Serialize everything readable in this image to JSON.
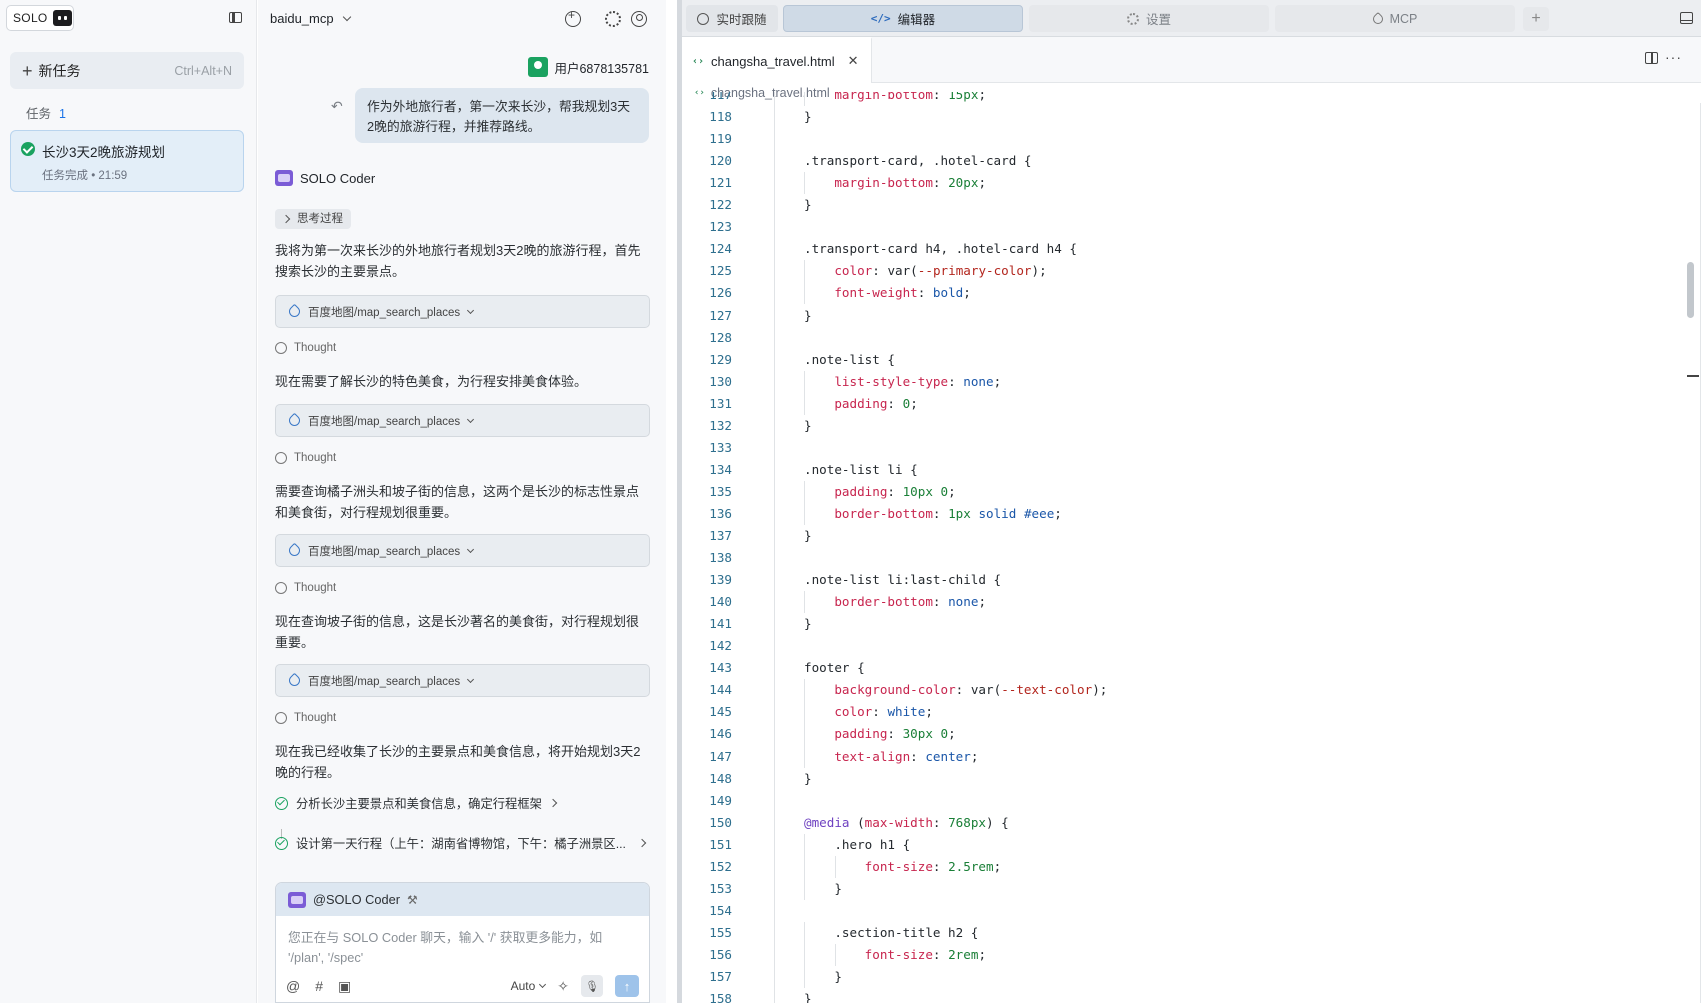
{
  "sidebar": {
    "logo_text": "SOLO",
    "new_task_label": "新任务",
    "new_task_shortcut": "Ctrl+Alt+N",
    "tasks_heading": "任务",
    "tasks_count": "1",
    "task": {
      "title": "长沙3天2晚旅游规划",
      "status": "任务完成 • 21:59"
    }
  },
  "chat": {
    "project_name": "baidu_mcp",
    "user_name": "用户6878135781",
    "user_message": "作为外地旅行者，第一次来长沙，帮我规划3天2晚的旅游行程，并推荐路线。",
    "agent_name": "SOLO Coder",
    "think_chip": "思考过程",
    "paragraphs": [
      "我将为第一次来长沙的外地旅行者规划3天2晚的旅游行程，首先搜索长沙的主要景点。",
      "现在需要了解长沙的特色美食，为行程安排美食体验。",
      "需要查询橘子洲头和坡子街的信息，这两个是长沙的标志性景点和美食街，对行程规划很重要。",
      "现在查询坡子街的信息，这是长沙著名的美食街，对行程规划很重要。",
      "现在我已经收集了长沙的主要景点和美食信息，将开始规划3天2晚的行程。"
    ],
    "tool_label": "百度地图/map_search_places",
    "thought_label": "Thought",
    "steps": [
      "分析长沙主要景点和美食信息，确定行程框架",
      "设计第一天行程（上午：湖南省博物馆，下午：橘子洲景区..."
    ],
    "input": {
      "mention": "@SOLO Coder",
      "placeholder": "您正在与 SOLO Coder 聊天，输入 '/' 获取更多能力，如 '/plan', '/spec'",
      "mode": "Auto"
    }
  },
  "editor": {
    "tabs": [
      "实时跟随",
      "编辑器",
      "设置",
      "MCP"
    ],
    "active_tab": "编辑器",
    "file_name": "changsha_travel.html",
    "breadcrumb": "changsha_travel.html",
    "first_line": 117,
    "lines": [
      "    margin-bottom: 15px;",
      "}",
      "",
      ".transport-card, .hotel-card {",
      "    margin-bottom: 20px;",
      "}",
      "",
      ".transport-card h4, .hotel-card h4 {",
      "    color: var(--primary-color);",
      "    font-weight: bold;",
      "}",
      "",
      ".note-list {",
      "    list-style-type: none;",
      "    padding: 0;",
      "}",
      "",
      ".note-list li {",
      "    padding: 10px 0;",
      "    border-bottom: 1px solid #eee;",
      "}",
      "",
      ".note-list li:last-child {",
      "    border-bottom: none;",
      "}",
      "",
      "footer {",
      "    background-color: var(--text-color);",
      "    color: white;",
      "    padding: 30px 0;",
      "    text-align: center;",
      "}",
      "",
      "@media (max-width: 768px) {",
      "    .hero h1 {",
      "        font-size: 2.5rem;",
      "    }",
      "",
      "    .section-title h2 {",
      "        font-size: 2rem;",
      "    }",
      "}"
    ]
  }
}
